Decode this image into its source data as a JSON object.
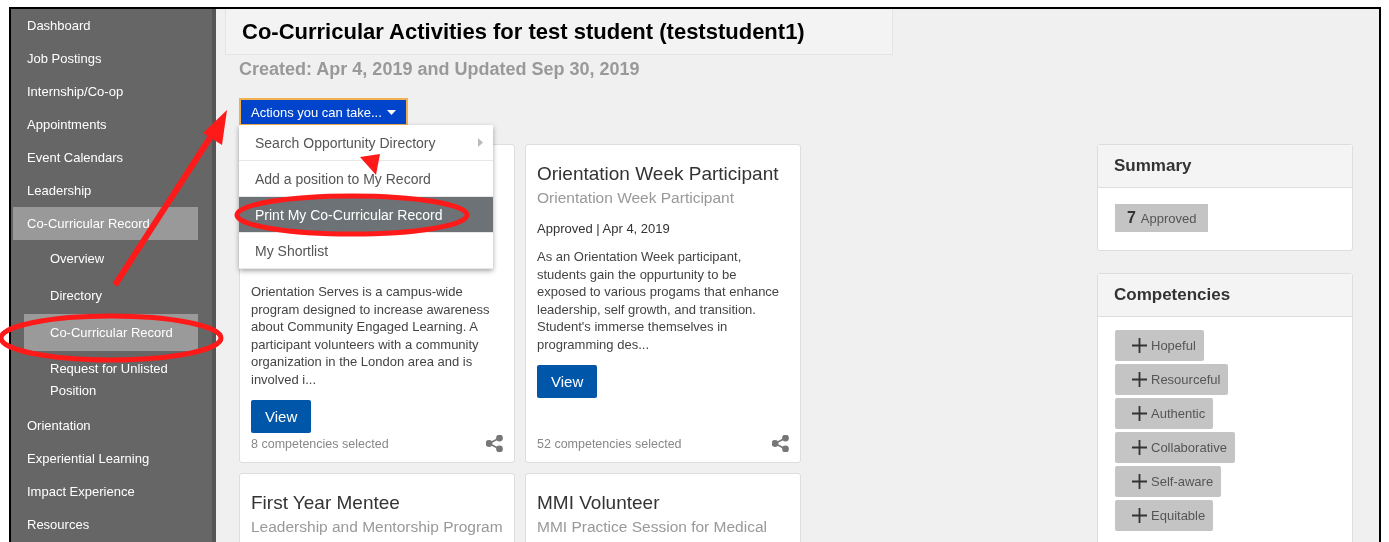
{
  "sidebar": {
    "items": [
      {
        "label": "Dashboard",
        "selected": false
      },
      {
        "label": "Job Postings",
        "selected": false
      },
      {
        "label": "Internship/Co-op",
        "selected": false
      },
      {
        "label": "Appointments",
        "selected": false
      },
      {
        "label": "Event Calendars",
        "selected": false
      },
      {
        "label": "Leadership",
        "selected": false
      },
      {
        "label": "Co-Curricular Record",
        "selected": true,
        "children": [
          {
            "label": "Overview",
            "selected": false
          },
          {
            "label": "Directory",
            "selected": false
          },
          {
            "label": "Co-Curricular Record",
            "selected": true
          },
          {
            "label": "Request for Unlisted Position",
            "selected": false
          }
        ]
      },
      {
        "label": "Orientation",
        "selected": false
      },
      {
        "label": "Experiential Learning",
        "selected": false
      },
      {
        "label": "Impact Experience",
        "selected": false
      },
      {
        "label": "Resources",
        "selected": false
      }
    ]
  },
  "header": {
    "title": "Co-Curricular Activities for test student (teststudent1)",
    "subtitle": "Created: Apr 4, 2019 and Updated Sep 30, 2019"
  },
  "actions": {
    "label": "Actions you can take...",
    "expanded": true,
    "menu": [
      {
        "label": "Search Opportunity Directory",
        "has_submenu": true,
        "selected": false
      },
      {
        "label": "Add a position to My Record",
        "has_submenu": false,
        "selected": false
      },
      {
        "label": "Print My Co-Curricular Record",
        "has_submenu": false,
        "selected": true
      },
      {
        "label": "My Shortlist",
        "has_submenu": false,
        "selected": false
      }
    ]
  },
  "partly_hidden_card": {
    "description": "Orientation Serves is a campus-wide program designed to increase awareness about Community Engaged Learning. A participant volunteers with a community organization in the London area and is involved i...",
    "action": "View",
    "competencies": "8 competencies selected"
  },
  "cards": [
    {
      "title": "Orientation Week Participant",
      "subtitle": "Orientation Week Participant",
      "status": "Approved | Apr 4, 2019",
      "description": "As an Orientation Week participant, students gain the oppurtunity to be exposed to various progams that enhance leadership, self growth, and transition. Student's immerse themselves in programming des...",
      "action": "View",
      "competencies": "52 competencies selected"
    },
    {
      "title": "First Year Mentee",
      "subtitle": "Leadership and Mentorship Program"
    },
    {
      "title": "MMI Volunteer",
      "subtitle": "MMI Practice Session for Medical"
    }
  ],
  "summary": {
    "title": "Summary",
    "count": "7",
    "label": "Approved"
  },
  "competencies": {
    "title": "Competencies",
    "items": [
      "Hopeful",
      "Resourceful",
      "Authentic",
      "Collaborative",
      "Self-aware",
      "Equitable"
    ]
  }
}
